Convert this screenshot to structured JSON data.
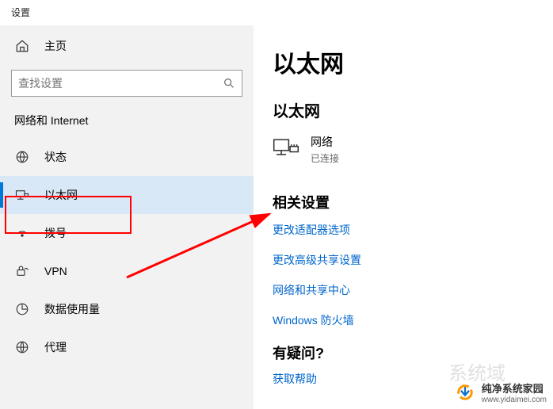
{
  "window": {
    "title": "设置"
  },
  "sidebar": {
    "home": "主页",
    "search_placeholder": "查找设置",
    "section": "网络和 Internet",
    "items": [
      {
        "label": "状态"
      },
      {
        "label": "以太网"
      },
      {
        "label": "拨号"
      },
      {
        "label": "VPN"
      },
      {
        "label": "数据使用量"
      },
      {
        "label": "代理"
      }
    ]
  },
  "main": {
    "title": "以太网",
    "subhead": "以太网",
    "network": {
      "name": "网络",
      "status": "已连接"
    },
    "related_title": "相关设置",
    "links": {
      "adapter": "更改适配器选项",
      "sharing": "更改高级共享设置",
      "center": "网络和共享中心",
      "firewall": "Windows 防火墙"
    },
    "faq_title": "有疑问?",
    "faq_link": "获取帮助"
  },
  "watermark": {
    "name": "纯净系统家园",
    "url": "www.yidaimei.com"
  },
  "ghost": "系统域"
}
